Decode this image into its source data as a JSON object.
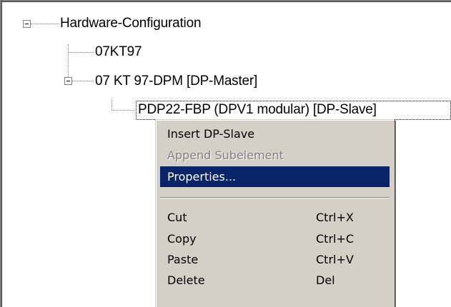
{
  "tree": {
    "root_label": "Hardware-Configuration",
    "node_07kt97_label": "07KT97",
    "node_dpm_label": "07 KT 97-DPM [DP-Master]",
    "node_slave_label": "PDP22-FBP (DPV1 modular) [DP-Slave]"
  },
  "context_menu": {
    "items": [
      {
        "label": "Insert DP-Slave",
        "shortcut": "",
        "state": "normal"
      },
      {
        "label": "Append Subelement",
        "shortcut": "",
        "state": "disabled"
      },
      {
        "label": "Properties...",
        "shortcut": "",
        "state": "highlighted"
      },
      {
        "label": "Cut",
        "shortcut": "Ctrl+X",
        "state": "normal"
      },
      {
        "label": "Copy",
        "shortcut": "Ctrl+C",
        "state": "normal"
      },
      {
        "label": "Paste",
        "shortcut": "Ctrl+V",
        "state": "normal"
      },
      {
        "label": "Delete",
        "shortcut": "Del",
        "state": "normal"
      }
    ]
  },
  "colors": {
    "highlight": "#0a246a",
    "menu_background": "#d4d0c8",
    "disabled_text": "#808080"
  },
  "icons": {
    "collapse_expander": "minus-box-icon"
  }
}
